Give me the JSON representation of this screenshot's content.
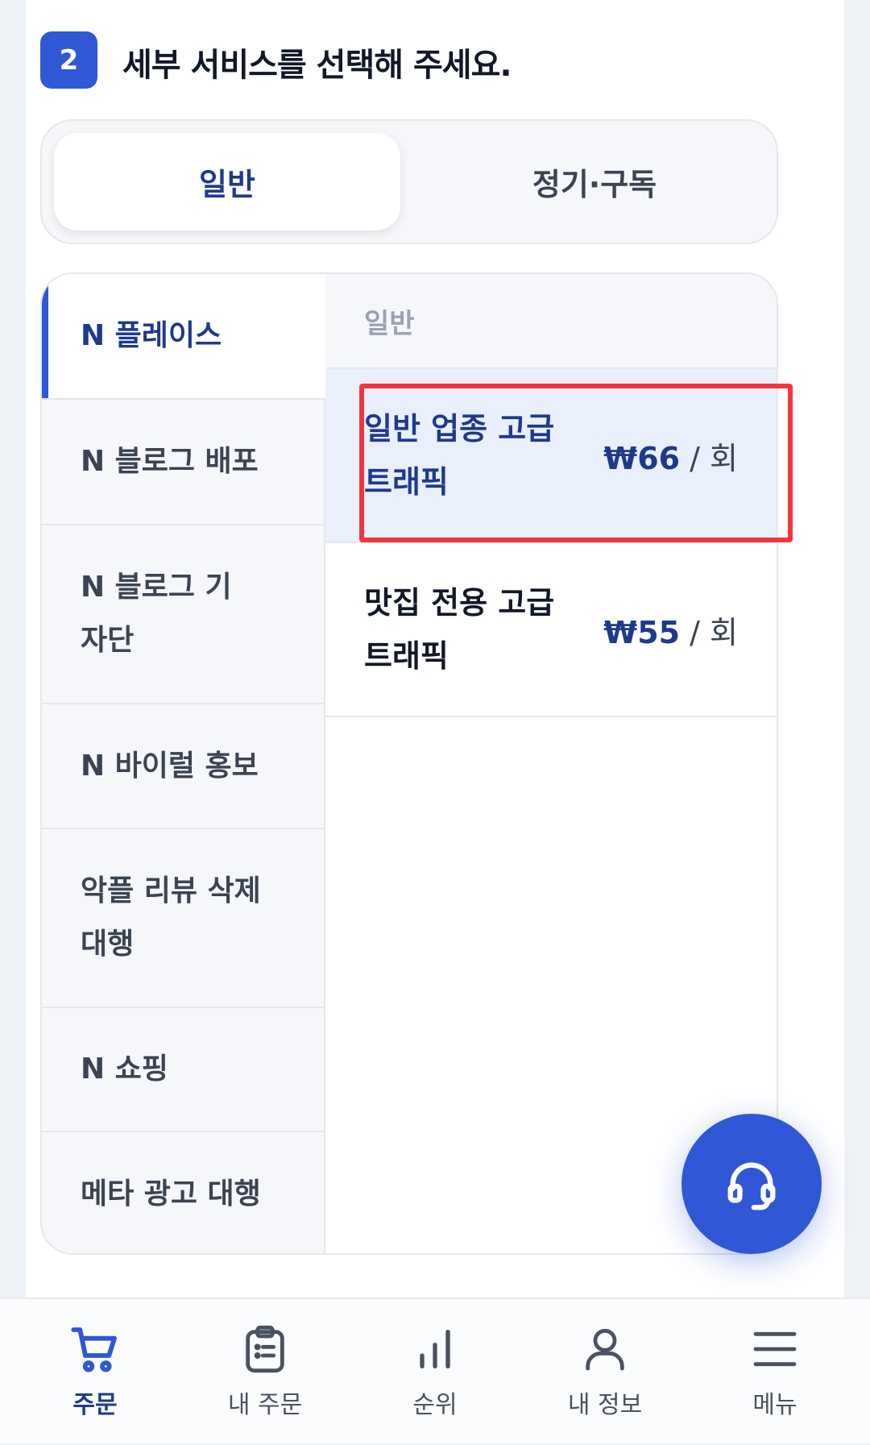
{
  "step": {
    "number": "2",
    "title": "세부 서비스를 선택해 주세요."
  },
  "tabs": [
    {
      "label": "일반",
      "active": true
    },
    {
      "label": "정기·구독",
      "active": false
    }
  ],
  "categories": [
    {
      "label": "N 플레이스",
      "active": true
    },
    {
      "label": "N 블로그 배포",
      "active": false
    },
    {
      "label": "N 블로그 기자단",
      "active": false
    },
    {
      "label": "N 바이럴 홍보",
      "active": false
    },
    {
      "label": "악플 리뷰 삭제 대행",
      "active": false
    },
    {
      "label": "N 쇼핑",
      "active": false
    },
    {
      "label": "메타 광고 대행",
      "active": false
    }
  ],
  "services": {
    "header": "일반",
    "items": [
      {
        "name": "일반 업종 고급 트래픽",
        "price": "₩66",
        "unit": " / 회",
        "selected": true
      },
      {
        "name": "맛집 전용 고급 트래픽",
        "price": "₩55",
        "unit": " / 회",
        "selected": false
      }
    ]
  },
  "fab": {
    "icon": "headset-icon"
  },
  "bottom_nav": [
    {
      "label": "주문",
      "icon": "cart-icon",
      "active": true
    },
    {
      "label": "내 주문",
      "icon": "clipboard-icon",
      "active": false
    },
    {
      "label": "순위",
      "icon": "bar-chart-icon",
      "active": false
    },
    {
      "label": "내 정보",
      "icon": "user-icon",
      "active": false
    },
    {
      "label": "메뉴",
      "icon": "menu-icon",
      "active": false
    }
  ],
  "colors": {
    "accent": "#2f57d6",
    "accent_dark": "#1e3a8a",
    "selected_bg": "#e9effb",
    "highlight_border": "#f2353d"
  }
}
